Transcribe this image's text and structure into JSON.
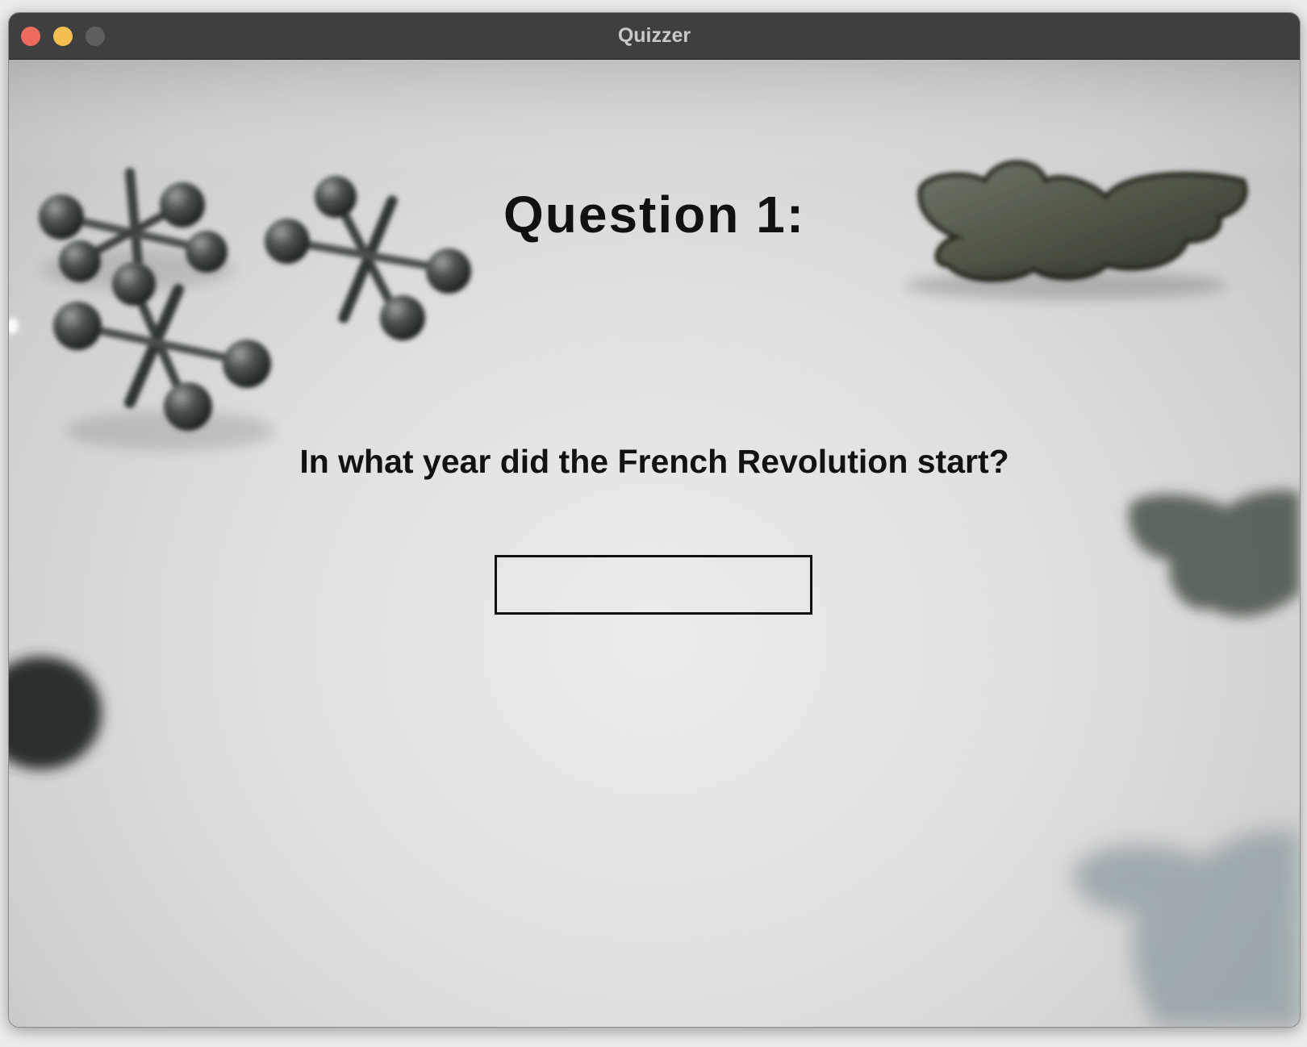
{
  "window": {
    "title": "Quizzer"
  },
  "quiz": {
    "heading": "Question 1:",
    "question": "In what year did the French Revolution start?",
    "answer_value": ""
  },
  "colors": {
    "titlebar": "#3f3f3f",
    "close": "#ed6a5e",
    "minimize": "#f5bf4f",
    "maximize_disabled": "#5f5f5f"
  }
}
